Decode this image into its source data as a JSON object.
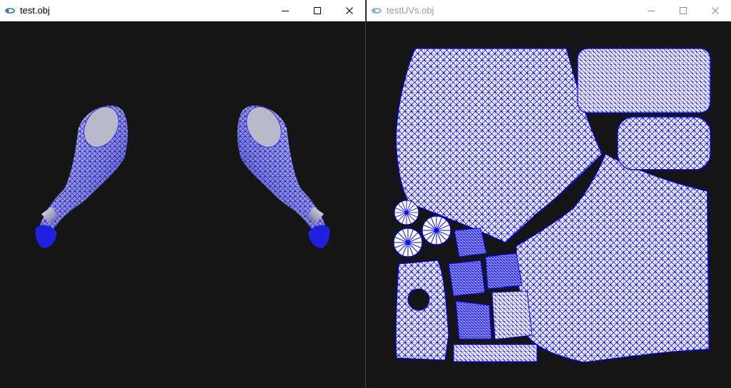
{
  "windows": [
    {
      "title": "test.obj",
      "active": true,
      "icon": "app-icon",
      "controls": [
        "minimize-icon",
        "maximize-icon",
        "close-icon"
      ]
    },
    {
      "title": "testUVs.obj",
      "active": false,
      "icon": "app-icon",
      "controls": [
        "minimize-icon",
        "maximize-icon",
        "close-icon"
      ]
    }
  ],
  "colors": {
    "viewport_bg": "#151515",
    "mesh_wire": "#0000ff",
    "mesh_fill": "#ffffff",
    "titlebar_bg": "#ffffff"
  }
}
